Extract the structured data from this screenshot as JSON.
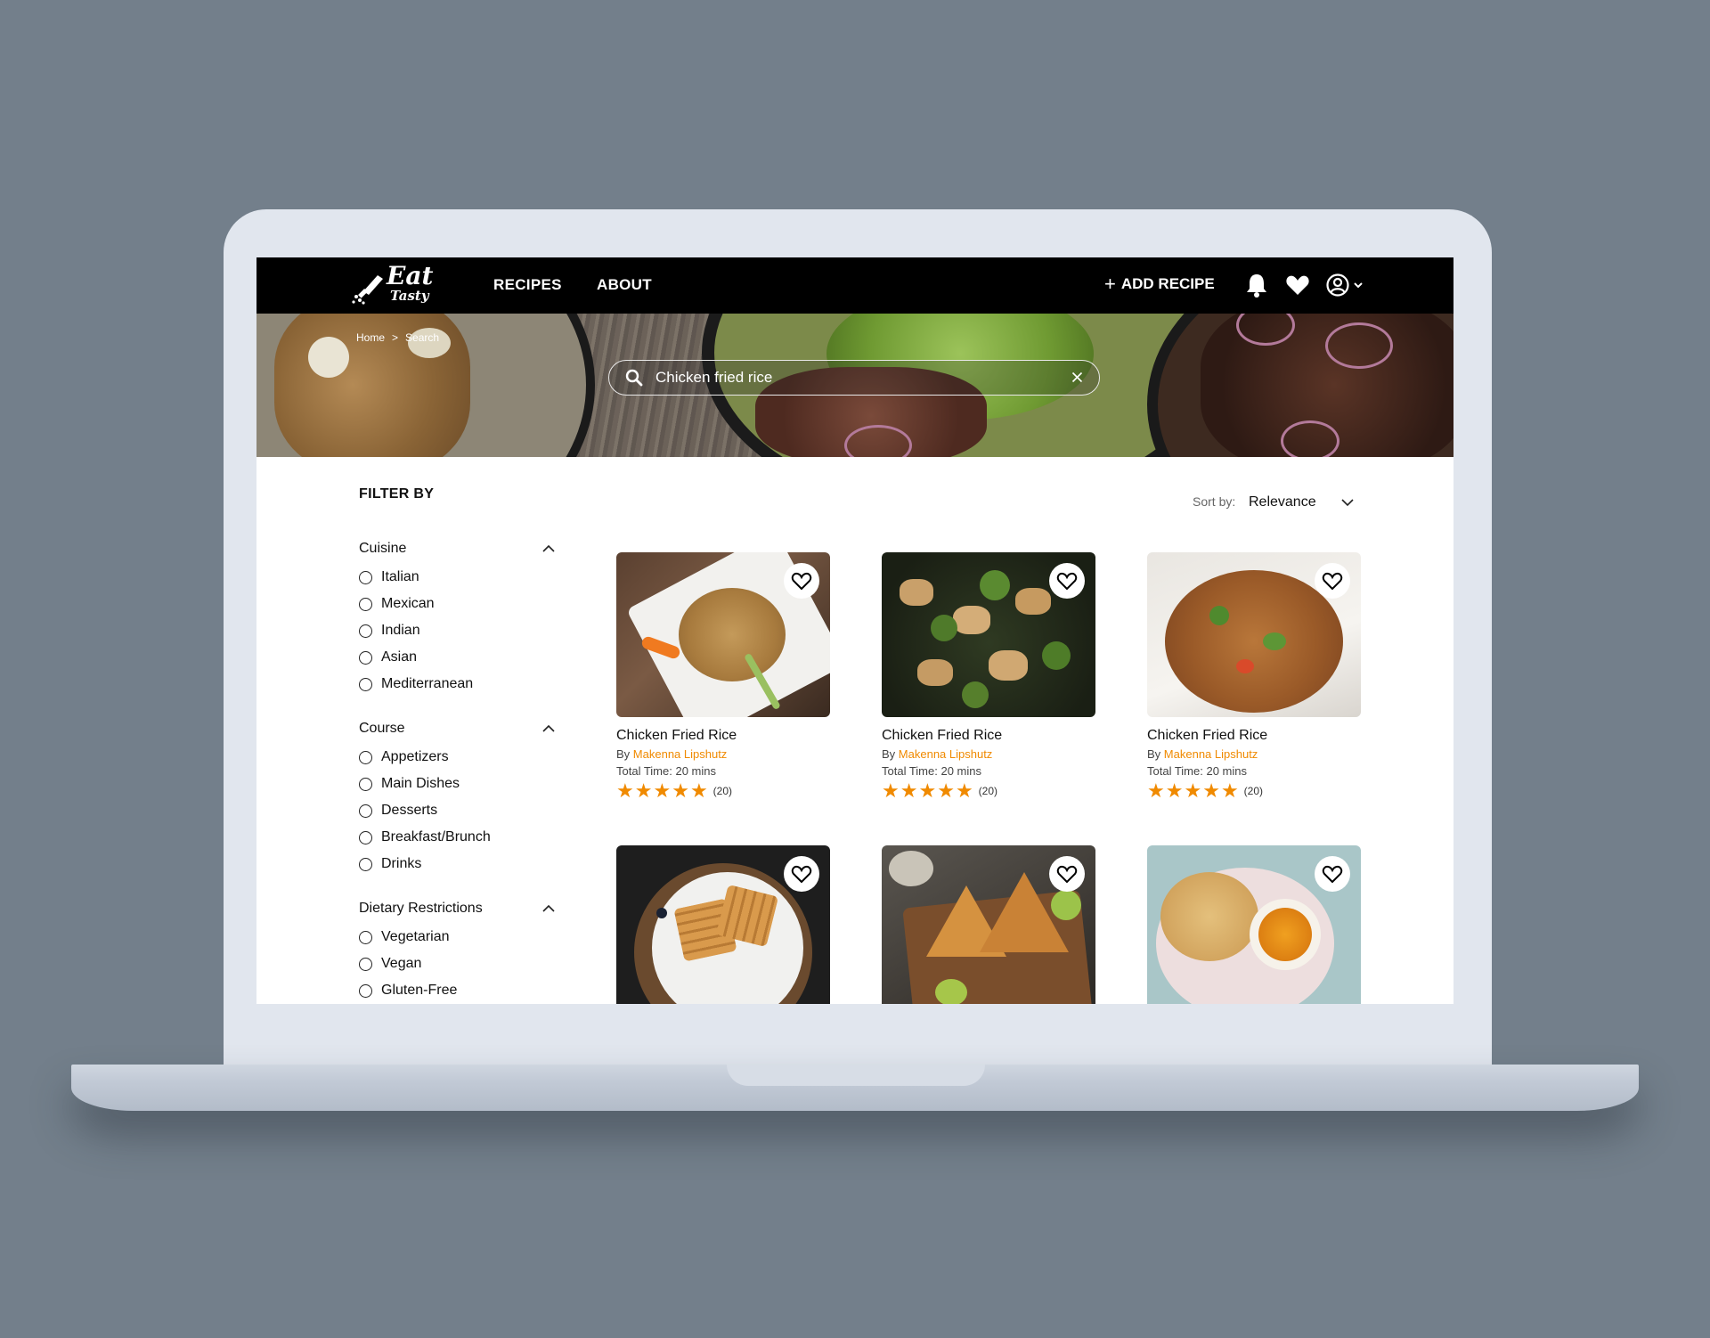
{
  "brand": {
    "name_line1": "Eat",
    "name_line2": "Tasty"
  },
  "nav": {
    "recipes": "RECIPES",
    "about": "ABOUT",
    "add_recipe": "ADD RECIPE",
    "add_icon": "plus-icon"
  },
  "breadcrumb": {
    "home": "Home",
    "separator": ">",
    "current": "Search"
  },
  "search": {
    "value": "Chicken fried rice"
  },
  "filters": {
    "title": "FILTER BY",
    "groups": [
      {
        "title": "Cuisine",
        "options": [
          "Italian",
          "Mexican",
          "Indian",
          "Asian",
          "Mediterranean"
        ]
      },
      {
        "title": "Course",
        "options": [
          "Appetizers",
          "Main Dishes",
          "Desserts",
          "Breakfast/Brunch",
          "Drinks"
        ]
      },
      {
        "title": "Dietary Restrictions",
        "options": [
          "Vegetarian",
          "Vegan",
          "Gluten-Free"
        ]
      }
    ]
  },
  "sort": {
    "label": "Sort by:",
    "value": "Relevance"
  },
  "recipes": [
    {
      "title": "Chicken Fried Rice",
      "by": "By",
      "author": "Makenna Lipshutz",
      "time": "Total Time: 20 mins",
      "rating": 5,
      "count": "(20)"
    },
    {
      "title": "Chicken Fried Rice",
      "by": "By",
      "author": "Makenna Lipshutz",
      "time": "Total Time: 20 mins",
      "rating": 5,
      "count": "(20)"
    },
    {
      "title": "Chicken Fried Rice",
      "by": "By",
      "author": "Makenna Lipshutz",
      "time": "Total Time: 20 mins",
      "rating": 5,
      "count": "(20)"
    }
  ],
  "colors": {
    "accent": "#f08a00",
    "nav_bg": "#000000",
    "backdrop": "#737f8b",
    "frame": "#e1e6ee"
  }
}
